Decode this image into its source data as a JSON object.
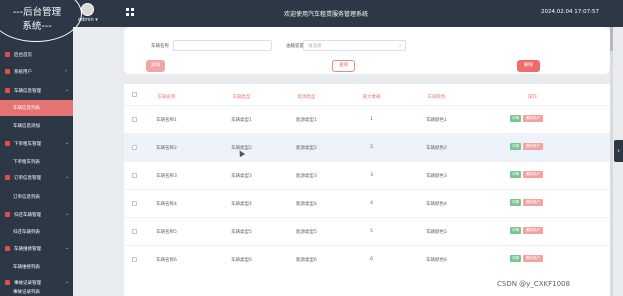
{
  "header": {
    "brand_line1": "---后台管理",
    "brand_line2": "系统---",
    "user_name": "admin ▾",
    "system_title": "欢迎使用汽车租赁服务管理系统",
    "datetime": "2024.02.04 17:07:57"
  },
  "sidebar": {
    "items": [
      {
        "label": "后台首页",
        "chevron": ""
      },
      {
        "label": "系统用户",
        "chevron": "›"
      },
      {
        "label": "车辆信息管理",
        "chevron": "⌄"
      },
      {
        "label": "车辆信息列表",
        "chevron": ""
      },
      {
        "label": "车辆信息添加",
        "chevron": ""
      },
      {
        "label": "下单租车管理",
        "chevron": "⌄"
      },
      {
        "label": "下单租车列表",
        "chevron": ""
      },
      {
        "label": "订单信息管理",
        "chevron": "⌄"
      },
      {
        "label": "订单信息列表",
        "chevron": ""
      },
      {
        "label": "归还车辆管理",
        "chevron": "⌄"
      },
      {
        "label": "归还车辆列表",
        "chevron": ""
      },
      {
        "label": "车辆维修管理",
        "chevron": "⌄"
      },
      {
        "label": "车辆维修列表",
        "chevron": ""
      },
      {
        "label": "事故记录管理",
        "chevron": "⌄"
      },
      {
        "label": "事故记录列表",
        "chevron": ""
      }
    ]
  },
  "search": {
    "name_label": "车辆名称",
    "name_value": "",
    "type_label": "油箱容量",
    "type_placeholder": "请选择",
    "chevron": "⌄",
    "add_label": "添加",
    "search_label": "查询",
    "delete_label": "删除"
  },
  "table": {
    "headers": [
      "车辆名称",
      "车辆类型",
      "能源类型",
      "最大乘载",
      "车辆颜色",
      "操作"
    ],
    "rows": [
      [
        "车辆名称1",
        "车辆类型1",
        "能源类型1",
        "1",
        "车辆颜色1"
      ],
      [
        "车辆名称2",
        "车辆类型2",
        "能源类型2",
        "2",
        "车辆颜色2"
      ],
      [
        "车辆名称3",
        "车辆类型3",
        "能源类型3",
        "3",
        "车辆颜色3"
      ],
      [
        "车辆名称4",
        "车辆类型4",
        "能源类型4",
        "4",
        "车辆颜色4"
      ],
      [
        "车辆名称5",
        "车辆类型5",
        "能源类型5",
        "5",
        "车辆颜色5"
      ],
      [
        "车辆名称6",
        "车辆类型6",
        "能源类型6",
        "6",
        "车辆颜色6"
      ]
    ],
    "edit_label": "详情",
    "delete_label": "删除用户"
  },
  "side_toggle": "›",
  "watermark": "CSDN @y_CXKF1008",
  "colors": {
    "sidebar_bg": "#2d3846",
    "accent": "#e57373",
    "header_text": "#f07b7b"
  }
}
